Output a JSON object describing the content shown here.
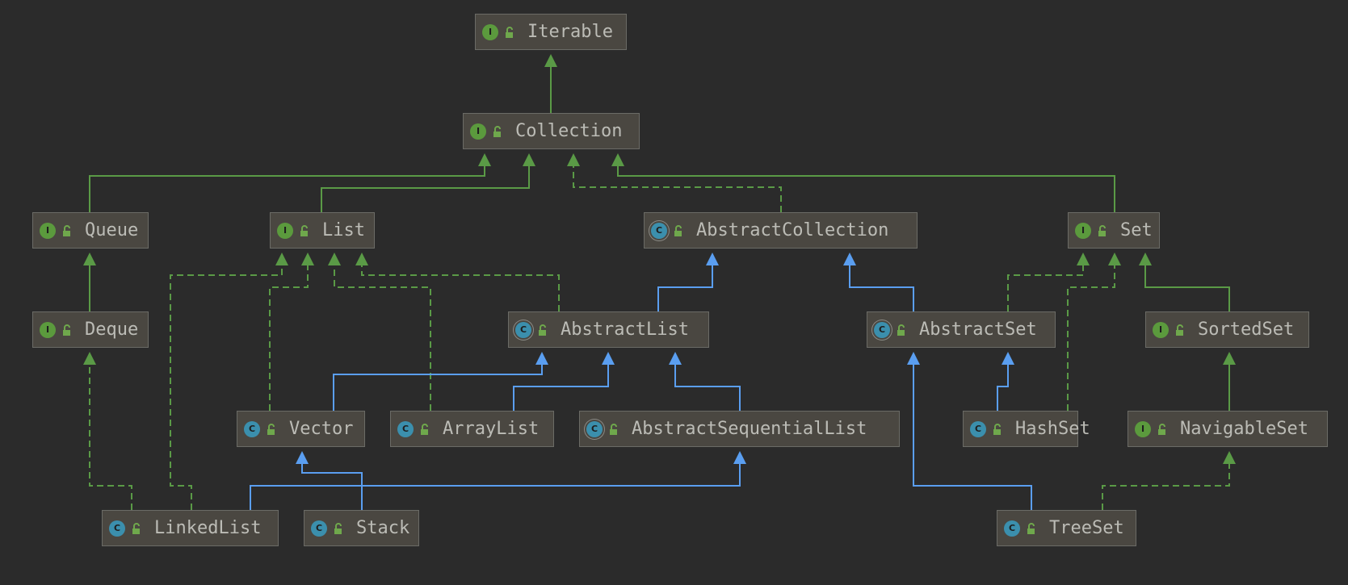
{
  "diagram": {
    "nodes": {
      "iterable": {
        "label": "Iterable",
        "kind": "interface",
        "icon": "interface-icon"
      },
      "collection": {
        "label": "Collection",
        "kind": "interface",
        "icon": "interface-icon"
      },
      "queue": {
        "label": "Queue",
        "kind": "interface",
        "icon": "interface-icon"
      },
      "list": {
        "label": "List",
        "kind": "interface",
        "icon": "interface-icon"
      },
      "abstractcollection": {
        "label": "AbstractCollection",
        "kind": "abstract",
        "icon": "abstract-class-icon"
      },
      "set": {
        "label": "Set",
        "kind": "interface",
        "icon": "interface-icon"
      },
      "deque": {
        "label": "Deque",
        "kind": "interface",
        "icon": "interface-icon"
      },
      "abstractlist": {
        "label": "AbstractList",
        "kind": "abstract",
        "icon": "abstract-class-icon"
      },
      "abstractset": {
        "label": "AbstractSet",
        "kind": "abstract",
        "icon": "abstract-class-icon"
      },
      "sortedset": {
        "label": "SortedSet",
        "kind": "interface",
        "icon": "interface-icon"
      },
      "vector": {
        "label": "Vector",
        "kind": "class",
        "icon": "class-icon"
      },
      "arraylist": {
        "label": "ArrayList",
        "kind": "class",
        "icon": "class-icon"
      },
      "abstractsequentiallist": {
        "label": "AbstractSequentialList",
        "kind": "abstract",
        "icon": "abstract-class-icon"
      },
      "hashset": {
        "label": "HashSet",
        "kind": "class",
        "icon": "class-icon"
      },
      "navigableset": {
        "label": "NavigableSet",
        "kind": "interface",
        "icon": "interface-icon"
      },
      "linkedlist": {
        "label": "LinkedList",
        "kind": "class",
        "icon": "class-icon"
      },
      "stack": {
        "label": "Stack",
        "kind": "class",
        "icon": "class-icon"
      },
      "treeset": {
        "label": "TreeSet",
        "kind": "class",
        "icon": "class-icon"
      }
    },
    "kind_glyphs": {
      "interface": "I",
      "class": "C",
      "abstract": "C"
    },
    "edges": [
      {
        "from": "collection",
        "to": "iterable",
        "type": "inherits"
      },
      {
        "from": "queue",
        "to": "collection",
        "type": "inherits"
      },
      {
        "from": "list",
        "to": "collection",
        "type": "inherits"
      },
      {
        "from": "abstractcollection",
        "to": "collection",
        "type": "implements"
      },
      {
        "from": "set",
        "to": "collection",
        "type": "inherits"
      },
      {
        "from": "deque",
        "to": "queue",
        "type": "inherits"
      },
      {
        "from": "linkedlist",
        "to": "deque",
        "type": "implements"
      },
      {
        "from": "linkedlist",
        "to": "list",
        "type": "implements"
      },
      {
        "from": "vector",
        "to": "list",
        "type": "implements"
      },
      {
        "from": "arraylist",
        "to": "list",
        "type": "implements"
      },
      {
        "from": "abstractlist",
        "to": "list",
        "type": "implements"
      },
      {
        "from": "abstractlist",
        "to": "abstractcollection",
        "type": "extends"
      },
      {
        "from": "abstractset",
        "to": "abstractcollection",
        "type": "extends"
      },
      {
        "from": "abstractset",
        "to": "set",
        "type": "implements"
      },
      {
        "from": "hashset",
        "to": "set",
        "type": "implements"
      },
      {
        "from": "sortedset",
        "to": "set",
        "type": "inherits"
      },
      {
        "from": "vector",
        "to": "abstractlist",
        "type": "extends"
      },
      {
        "from": "arraylist",
        "to": "abstractlist",
        "type": "extends"
      },
      {
        "from": "abstractsequentiallist",
        "to": "abstractlist",
        "type": "extends"
      },
      {
        "from": "hashset",
        "to": "abstractset",
        "type": "extends"
      },
      {
        "from": "treeset",
        "to": "abstractset",
        "type": "extends"
      },
      {
        "from": "navigableset",
        "to": "sortedset",
        "type": "inherits"
      },
      {
        "from": "stack",
        "to": "vector",
        "type": "extends"
      },
      {
        "from": "linkedlist",
        "to": "abstractsequentiallist",
        "type": "extends"
      },
      {
        "from": "treeset",
        "to": "navigableset",
        "type": "implements"
      }
    ],
    "colors": {
      "background": "#2b2b2b",
      "node_fill": "#4a4741",
      "interface_inheritance": "#5a9a46",
      "class_extension": "#5a9ef0",
      "interface_icon": "#5b9a3d",
      "class_icon": "#3b8fad"
    }
  }
}
